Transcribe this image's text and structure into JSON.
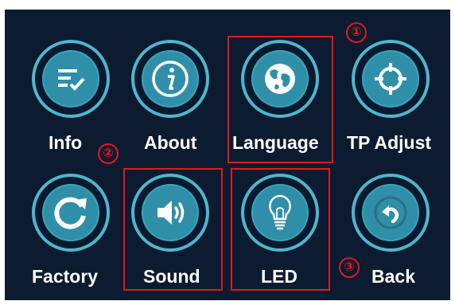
{
  "menu": {
    "items": [
      {
        "id": "info",
        "label": "Info",
        "icon": "checklist-icon"
      },
      {
        "id": "about",
        "label": "About",
        "icon": "info-icon"
      },
      {
        "id": "language",
        "label": "Language",
        "icon": "globe-icon"
      },
      {
        "id": "tp_adjust",
        "label": "TP Adjust",
        "icon": "crosshair-icon"
      },
      {
        "id": "factory",
        "label": "Factory",
        "icon": "refresh-icon"
      },
      {
        "id": "sound",
        "label": "Sound",
        "icon": "speaker-icon"
      },
      {
        "id": "led",
        "label": "LED",
        "icon": "lightbulb-icon"
      },
      {
        "id": "back",
        "label": "Back",
        "icon": "back-arrow-icon"
      }
    ]
  },
  "annotations": {
    "marker_1": "①",
    "marker_2": "②",
    "marker_3": "③",
    "highlight_color": "#e1191f"
  },
  "colors": {
    "background": "#0c1b30",
    "ring": "#4fb6cf",
    "button_fill": "#2f8fa8",
    "label": "#ffffff"
  }
}
